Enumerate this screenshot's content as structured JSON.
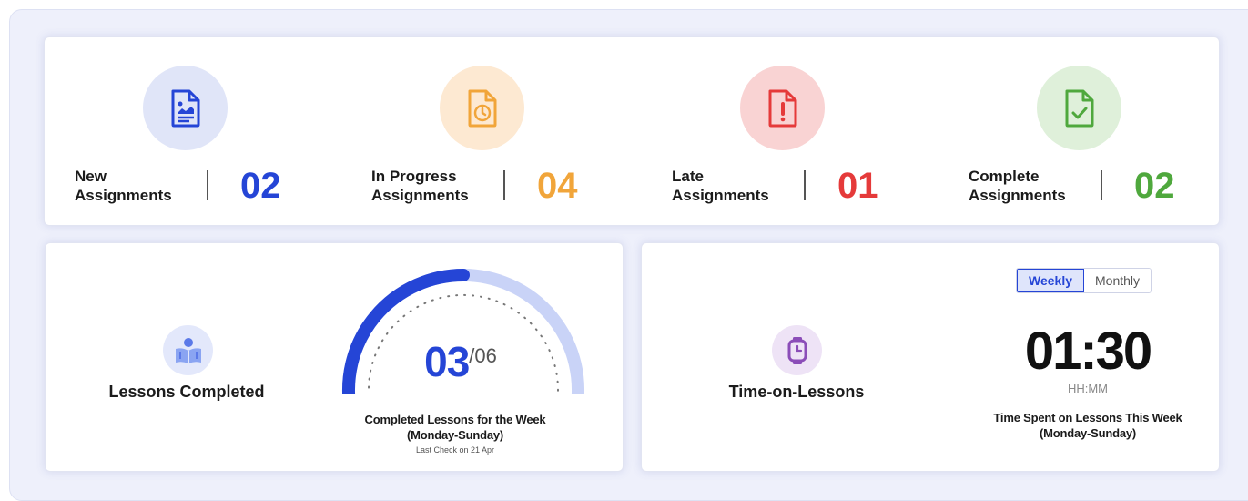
{
  "stats": [
    {
      "label_line1": "New",
      "label_line2": "Assignments",
      "count": "02",
      "color": "#2545d6",
      "bg": "#e0e5f8",
      "icon": "document-image-icon"
    },
    {
      "label_line1": "In Progress",
      "label_line2": "Assignments",
      "count": "04",
      "color": "#f1a53a",
      "bg": "#fde9d2",
      "icon": "document-clock-icon"
    },
    {
      "label_line1": "Late",
      "label_line2": "Assignments",
      "count": "01",
      "color": "#e53a3a",
      "bg": "#f9d3d3",
      "icon": "document-alert-icon"
    },
    {
      "label_line1": "Complete",
      "label_line2": "Assignments",
      "count": "02",
      "color": "#4fa83d",
      "bg": "#dff0da",
      "icon": "document-check-icon"
    }
  ],
  "lessons": {
    "label": "Lessons Completed",
    "icon": "reading-person-icon",
    "completed": "03",
    "total": "/06",
    "progress_fraction": 0.5,
    "caption_line1": "Completed Lessons for the Week",
    "caption_line2": "(Monday-Sunday)",
    "note": "Last Check on 21 Apr"
  },
  "time": {
    "label": "Time-on-Lessons",
    "icon": "watch-icon",
    "tabs": [
      {
        "label": "Weekly",
        "active": true
      },
      {
        "label": "Monthly",
        "active": false
      }
    ],
    "value": "01:30",
    "unit": "HH:MM",
    "caption_line1": "Time Spent on Lessons This Week",
    "caption_line2": "(Monday-Sunday)"
  },
  "colors": {
    "accent": "#2545d6",
    "gauge_track": "#c9d3f7"
  }
}
